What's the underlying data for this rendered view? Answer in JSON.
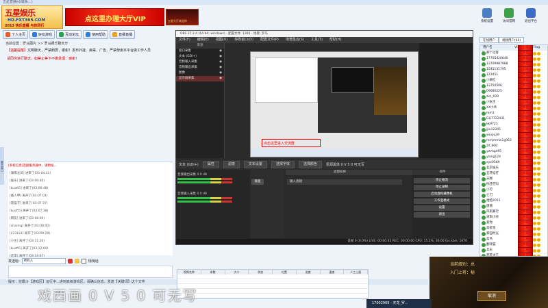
{
  "window": {
    "title": "五星直播间(联系...)"
  },
  "logo": {
    "line1": "五星娱乐",
    "line2": "HD.FXT365.COM",
    "line3": "2013 快乐直播 与你同行"
  },
  "vip_banner": "点这里办理大厅VIP",
  "ad_banner": "五星大厅欢迎你",
  "toolbar": [
    {
      "label": "个人主页",
      "icon": "home-icon",
      "color": "#e65b2a"
    },
    {
      "label": "好友游戏",
      "icon": "game-icon",
      "color": "#2a7fe6"
    },
    {
      "label": "互动论坛",
      "icon": "forum-icon",
      "color": "#2aa14a"
    },
    {
      "label": "使用帮助",
      "icon": "help-icon",
      "color": "#2a7fe6"
    },
    {
      "label": "直播直播",
      "icon": "tv-icon",
      "color": "#e6a22a"
    }
  ],
  "room": {
    "label": "当前位置：罗马图片 >> 罗马娱乐聊天厅"
  },
  "notice": {
    "prefix": "【温馨提醒】",
    "text": "文明聊天，严禁刷屏，谢谢！发布外挂、病毒、广告，严禁使用本平台做工作人员",
    "warn": "请同你进行聊天，如禁止等下不做处理：谢谢！"
  },
  "side_tab": "聊天窗口",
  "chat": {
    "system": "[系统信息]连接服务器中，请稍候...",
    "lines": [
      "[湖南龙凤] 进来了(03:04:31)",
      "[娱乐] 进来了(03:06:40)",
      "[kuoft5] 进来了(03:06:48)",
      "[路人甲] 离开了(03:07:01)",
      "[夜猫子] 进来了(03:07:37)",
      "[kuoft5] 离开了(03:07:38)",
      "[网友] 进来了(03:08:00)",
      "[sharing] 离开了(03:08:00)",
      "[4331x1] 离开了(03:09:29)",
      "[小王] 离开了(03:11:20)",
      "[kuoft5] 离开了(03:12:00)",
      "[老李] 离开了(03:14:07)"
    ]
  },
  "sendbar": {
    "label": "发送给:",
    "target": "所有人",
    "checkbox": "悄悄话"
  },
  "status": "提示：拉霸斗【游戏区】运行中...进到高级游戏区，请确认信息，发送【关键词】这个文件",
  "sheet": {
    "headers": [
      "视频名称",
      "参数",
      "大小",
      "状态",
      "位置",
      "进度",
      "速度",
      "人工上报"
    ]
  },
  "watermark": "戏西画 0 V 5 0 可无写",
  "obs": {
    "title": "OBS 27.2.4 (64-bit, windows) - 配置文件: 1365 - 场景: 罗马",
    "menu": [
      "文件(F)",
      "编辑(E)",
      "视图(V)",
      "停靠窗口(D)",
      "配置文件(P)",
      "场景集合(S)",
      "工具(T)",
      "帮助(H)"
    ],
    "scenes_header": "来源",
    "sources": [
      {
        "name": "窗口采集",
        "sel": false
      },
      {
        "name": "文本 (GDI+)",
        "sel": false
      },
      {
        "name": "音频输入采集",
        "sel": false
      },
      {
        "name": "音频输出采集",
        "sel": false
      },
      {
        "name": "图像",
        "sel": false
      },
      {
        "name": "显示器采集",
        "sel": true
      }
    ],
    "preview_red": "点击这里进入交流群",
    "ctl": {
      "source": "文本 (GDI+)",
      "buttons": [
        "属性",
        "滤镜",
        "文本设置",
        "选择字体",
        "选择颜色"
      ],
      "font": "思源黑体 0 V 5 0 可无写"
    },
    "mixer": [
      {
        "name": "音频输出采集",
        "db": "0.0 dB"
      },
      {
        "name": "音频输入采集",
        "db": "0.0 dB"
      }
    ],
    "transition": "渐变",
    "filters_header": "滤镜名称",
    "filter_row": "输入滤镜",
    "controls_header": "控件",
    "control_buttons": [
      "停止推流",
      "停止录制",
      "启动虚拟摄像机",
      "工作室模式",
      "设置",
      "退出"
    ],
    "status": "丢帧 0 (0.0%)   LIVE: 00:00:42   REC: 00:00:00   CPU: 15.2%, 30.00 fps   kb/s: 1670"
  },
  "right": {
    "icons": [
      {
        "label": "系统设置",
        "color": "#4a7fc2"
      },
      {
        "label": "访问官网",
        "color": "#3ca14a"
      },
      {
        "label": "退出平台",
        "color": "#3a6bc6"
      }
    ],
    "tabs": [
      "在线用户",
      "视频用户(40)"
    ],
    "headers": [
      "用户名",
      "VIP 等级",
      "IT Flag"
    ],
    "users": [
      {
        "name": "那个过客",
        "vip": "上级"
      },
      {
        "name": "17705420640",
        "vip": "神圣"
      },
      {
        "name": "13709987988",
        "vip": "神圣"
      },
      {
        "name": "1545131795",
        "vip": "神圣"
      },
      {
        "name": "123451",
        "vip": "上级"
      },
      {
        "name": "小柳红",
        "vip": "神圣"
      },
      {
        "name": "13750506",
        "vip": "神圣"
      },
      {
        "name": "09080225",
        "vip": "大员"
      },
      {
        "name": "zxc_020",
        "vip": "神圣"
      },
      {
        "name": "小张王",
        "vip": "神圣"
      },
      {
        "name": "XX小爷",
        "vip": "上级"
      },
      {
        "name": "mm1",
        "vip": "神圣"
      },
      {
        "name": "GG7722431",
        "vip": "大员"
      },
      {
        "name": "kk9721",
        "vip": "少将"
      },
      {
        "name": "jjiu12345",
        "vip": "少将"
      },
      {
        "name": "wuxjua9",
        "vip": "少将"
      },
      {
        "name": "mmjmmw1g963",
        "vip": "少将"
      },
      {
        "name": "zlf_666",
        "vip": "少将"
      },
      {
        "name": "ywmgd95",
        "vip": "少将"
      },
      {
        "name": "ylang124",
        "vip": "少将"
      },
      {
        "name": "xyx0589",
        "vip": "少将"
      },
      {
        "name": "北京娱乐",
        "vip": "上将"
      },
      {
        "name": "五开挂打",
        "vip": "上将"
      },
      {
        "name": "天赐",
        "vip": "神圣"
      },
      {
        "name": "你还在吗",
        "vip": "上将"
      },
      {
        "name": "小可",
        "vip": "上将"
      },
      {
        "name": "亡刀",
        "vip": "上将"
      },
      {
        "name": "哈哈2011",
        "vip": "神圣"
      },
      {
        "name": "唐僧",
        "vip": "上将"
      },
      {
        "name": "风雨兼行",
        "vip": "神圣"
      },
      {
        "name": "清雨小天",
        "vip": "神圣"
      },
      {
        "name": "爱你",
        "vip": "神圣"
      },
      {
        "name": "高星星",
        "vip": "少将"
      },
      {
        "name": "家园时光",
        "vip": "上将"
      },
      {
        "name": "高鸟",
        "vip": "上将"
      },
      {
        "name": "翻译猫",
        "vip": "上将"
      },
      {
        "name": "兵王",
        "vip": "神圣"
      },
      {
        "name": "苏苏大王",
        "vip": "上将"
      },
      {
        "name": "悟空七",
        "vip": "神圣"
      },
      {
        "name": "龙门人",
        "vip": "上将"
      },
      {
        "name": "大宝贝",
        "vip": "上将"
      }
    ]
  },
  "game": {
    "line1": "当前级别：总",
    "line2": "入门上将：秘",
    "button": "取消"
  },
  "taskbar": "17002969 - 天龙_罗..."
}
